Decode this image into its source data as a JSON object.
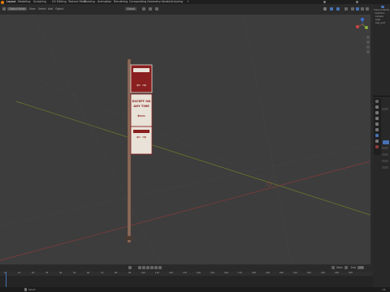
{
  "workspace_tabs": [
    "Layout",
    "Modeling",
    "Sculpting",
    "UV Editing",
    "Texture Paint",
    "Shading",
    "Animation",
    "Rendering",
    "Compositing",
    "Geometry Nodes",
    "Scripting",
    "+"
  ],
  "header": {
    "mode_label": "Object Mode",
    "menu_items": [
      "View",
      "Select",
      "Add",
      "Object"
    ],
    "transform_label": "Global"
  },
  "outliner": {
    "items": [
      "Scene Collection",
      "Collection",
      "Camera",
      "Light",
      "sign_post"
    ]
  },
  "viewport": {
    "sign": {
      "top_arrow": "⇐ ⇒",
      "middle_title": [
        "EXCEPT ON",
        "ANY TIME"
      ],
      "middle_arrow": "⟸",
      "bottom_arrow": "⇐ ⇒"
    }
  },
  "timeline": {
    "frame_ticks": [
      "0",
      "10",
      "20",
      "30",
      "40",
      "50",
      "60",
      "70",
      "80",
      "90",
      "100",
      "110",
      "120",
      "130",
      "140",
      "150",
      "160",
      "170",
      "180",
      "190",
      "200",
      "210",
      "220",
      "230",
      "240",
      "250"
    ],
    "current_frame": "1",
    "start_label": "Start",
    "start": "1",
    "end_label": "End",
    "end": "250"
  },
  "status": {
    "left": "Select",
    "right": "3.6"
  },
  "colors": {
    "accent": "#4772b3",
    "x_axis": "#8b3a3a",
    "y_axis": "#6b7f2a",
    "sign_red": "#8a1f1f",
    "sign_white": "#e8e2d8"
  }
}
